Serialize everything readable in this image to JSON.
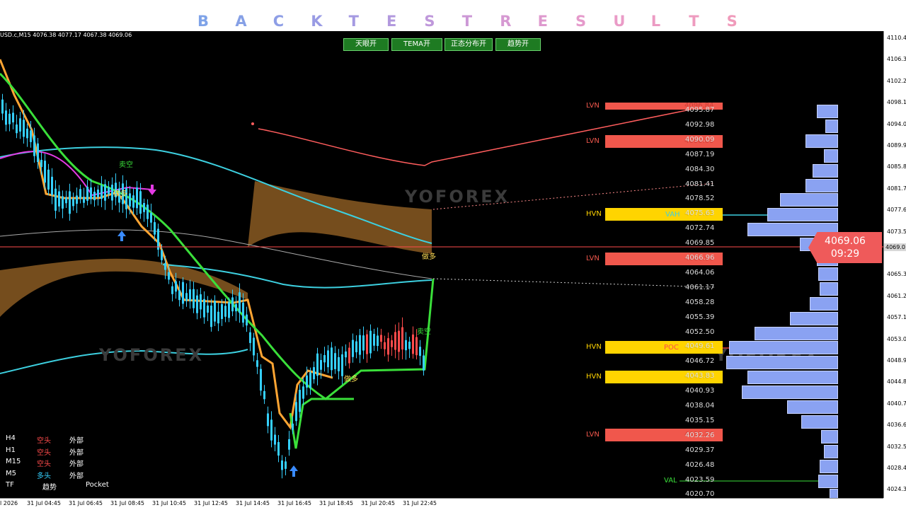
{
  "banner": {
    "letters": [
      {
        "t": "B",
        "c": "#7fa3e8"
      },
      {
        "t": "A",
        "c": "#86a0e6"
      },
      {
        "t": "C",
        "c": "#8e9ee6"
      },
      {
        "t": "K",
        "c": "#999be4"
      },
      {
        "t": "T",
        "c": "#a59ae2"
      },
      {
        "t": "E",
        "c": "#b299de"
      },
      {
        "t": "S",
        "c": "#bf98db"
      },
      {
        "t": "T",
        "c": "#cc98d6"
      },
      {
        "t": "R",
        "c": "#d699d2"
      },
      {
        "t": "E",
        "c": "#de99ce"
      },
      {
        "t": "S",
        "c": "#e59acb"
      },
      {
        "t": "U",
        "c": "#ea9bc7"
      },
      {
        "t": "L",
        "c": "#ec9bc3"
      },
      {
        "t": "T",
        "c": "#ee9bbf"
      },
      {
        "t": "S",
        "c": "#f09bbb"
      }
    ]
  },
  "symbol_info": "USD.c,M15  4076.38 4077.17 4067.38 4069.06",
  "buttons": [
    {
      "label": "天眼开"
    },
    {
      "label": "TEMA开"
    },
    {
      "label": "正态分布开"
    },
    {
      "label": "趋势开"
    }
  ],
  "yaxis_ticks": [
    "4110.4",
    "4106.3",
    "4102.2",
    "4098.1",
    "4094.0",
    "4089.9",
    "4085.8",
    "4081.7",
    "4077.6",
    "4073.5",
    "4069.0",
    "4065.3",
    "4061.2",
    "4057.1",
    "4053.0",
    "4048.9",
    "4044.8",
    "4040.7",
    "4036.6",
    "4032.5",
    "4028.4",
    "4024.3"
  ],
  "xaxis_ticks": [
    "l 2026",
    "31 Jul 04:45",
    "31 Jul 06:45",
    "31 Jul 08:45",
    "31 Jul 10:45",
    "31 Jul 12:45",
    "31 Jul 14:45",
    "31 Jul 16:45",
    "31 Jul 18:45",
    "31 Jul 20:45",
    "31 Jul 22:45"
  ],
  "price_levels": [
    "4095.87",
    "4092.98",
    "4090.09",
    "4087.19",
    "4084.30",
    "4081.41",
    "4078.52",
    "4075.63",
    "4072.74",
    "4069.85",
    "4066.96",
    "4064.06",
    "4061.17",
    "4058.28",
    "4055.39",
    "4052.50",
    "4049.61",
    "4046.72",
    "4043.83",
    "4040.93",
    "4038.04",
    "4035.15",
    "4032.26",
    "4029.37",
    "4026.48",
    "4023.59",
    "4020.70"
  ],
  "zones": [
    {
      "label": "LVN",
      "value": "4096.84",
      "color": "#f0574c",
      "label_color": "#f0574c"
    },
    {
      "label": "LVN",
      "value": "4090.09",
      "color": "#f0574c",
      "label_color": "#f0574c"
    },
    {
      "label": "HVN",
      "value": "4075.63",
      "color": "#ffd400",
      "label_color": "#ffd400"
    },
    {
      "label": "LVN",
      "value": "4066.96",
      "color": "#f0574c",
      "label_color": "#f0574c"
    },
    {
      "label": "HVN",
      "value": "4049.61",
      "color": "#ffd400",
      "label_color": "#ffd400"
    },
    {
      "label": "HVN",
      "value": "4043.83",
      "color": "#ffd400",
      "label_color": "#ffd400"
    },
    {
      "label": "LVN",
      "value": "4032.26",
      "color": "#f0574c",
      "label_color": "#f0574c"
    }
  ],
  "profile_labels": {
    "vah": "VAH",
    "poc": "POC",
    "val": "VAL"
  },
  "current_price": {
    "price": "4069.06",
    "timer": "09:29"
  },
  "axis_price_tag": "4069.0",
  "annotations": {
    "sell": "卖空",
    "buy": "做多"
  },
  "watermark": "YOFOREX",
  "tf_table": {
    "rows": [
      {
        "tf": "H4",
        "trend": "空头",
        "pos": "外部",
        "color": "#ff4b4b"
      },
      {
        "tf": "H1",
        "trend": "空头",
        "pos": "外部",
        "color": "#ff4b4b"
      },
      {
        "tf": "M15",
        "trend": "空头",
        "pos": "外部",
        "color": "#ff4b4b"
      },
      {
        "tf": "M5",
        "trend": "多头",
        "pos": "外部",
        "color": "#35d0ff"
      }
    ],
    "footer": {
      "tf": "TF",
      "trend": "趋势",
      "pos": "Pocket"
    }
  },
  "colors": {
    "bull": "#35d0ff",
    "bear": "#ff4b4b",
    "orange": "#ffa533",
    "green": "#3adf3a",
    "magenta": "#e43ae4",
    "cyan": "#3dd0e0",
    "band": "#8a5a22"
  }
}
